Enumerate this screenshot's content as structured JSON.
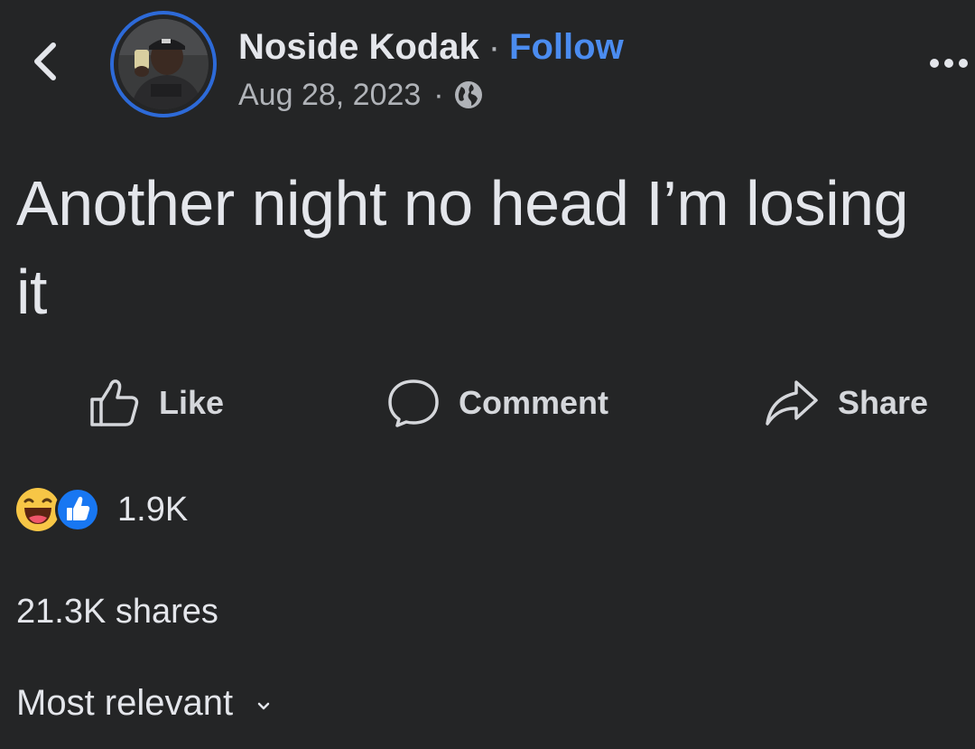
{
  "header": {
    "author_name": "Noside Kodak",
    "separator": "·",
    "follow_label": "Follow",
    "date": "Aug 28, 2023",
    "meta_separator": "·",
    "privacy_icon": "globe-icon",
    "back_icon": "chevron-left-icon",
    "more_icon": "more-options-icon"
  },
  "post": {
    "text": "Another night no head I’m losing it"
  },
  "actions": {
    "like_label": "Like",
    "comment_label": "Comment",
    "share_label": "Share"
  },
  "reactions": {
    "icons": [
      "haha-reaction-icon",
      "like-reaction-icon"
    ],
    "count": "1.9K"
  },
  "shares_text": "21.3K shares",
  "comments_sort": {
    "label": "Most relevant",
    "icon": "chevron-down-icon"
  },
  "colors": {
    "background": "#242526",
    "text": "#e4e6eb",
    "secondary_text": "#b0b3b8",
    "accent": "#4b8cf0",
    "avatar_ring": "#2d6ad8",
    "like_blue": "#1877f2",
    "haha_yellow": "#f7c646"
  }
}
